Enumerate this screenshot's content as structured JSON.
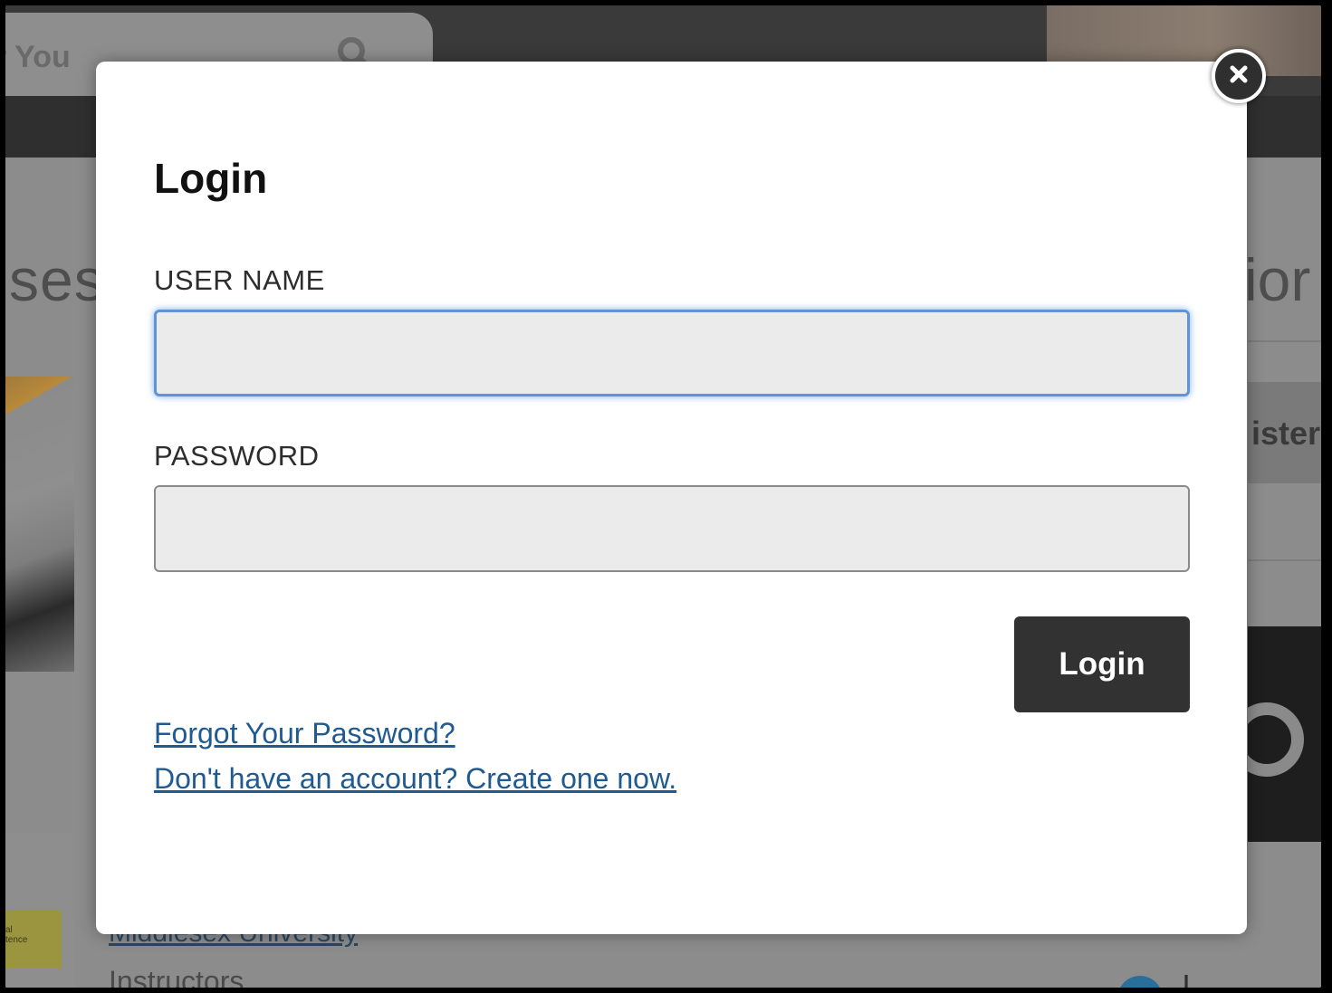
{
  "background_page": {
    "search_partial_text": "r You",
    "heading_left_partial": "ses",
    "heading_right_partial": "ior",
    "register_partial": "ister",
    "link_partial": "Middlesex University",
    "section_partial": "Instructors",
    "badge_partial_lines": [
      "al",
      "tence"
    ]
  },
  "modal": {
    "title": "Login",
    "username_label": "USER NAME",
    "username_value": "",
    "password_label": "PASSWORD",
    "password_value": "",
    "login_button": "Login",
    "forgot_password_link": "Forgot Your Password?",
    "create_account_link": "Don't have an account? Create one now.",
    "close_icon": "close-icon"
  },
  "colors": {
    "button_bg": "#323232",
    "link": "#1f5a91",
    "focus_ring": "#5e95d6",
    "input_bg": "#ebebeb"
  }
}
